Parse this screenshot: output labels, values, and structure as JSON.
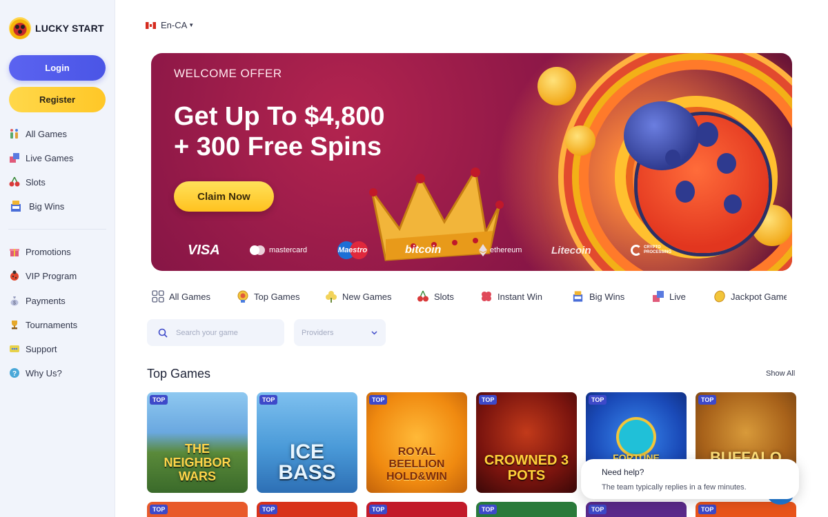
{
  "brand": {
    "name": "LUCKY START"
  },
  "auth": {
    "login_label": "Login",
    "register_label": "Register"
  },
  "sidebar": {
    "items": [
      {
        "label": "All Games",
        "icon": "all-games-icon"
      },
      {
        "label": "Live Games",
        "icon": "live-games-icon"
      },
      {
        "label": "Slots",
        "icon": "cherries-icon"
      },
      {
        "label": "Big Wins",
        "icon": "big-wins-icon"
      },
      {
        "label": "Promotions",
        "icon": "gift-icon"
      },
      {
        "label": "VIP Program",
        "icon": "ladybug-icon"
      },
      {
        "label": "Payments",
        "icon": "money-bag-icon"
      },
      {
        "label": "Tournaments",
        "icon": "trophy-icon"
      },
      {
        "label": "Support",
        "icon": "support-icon"
      },
      {
        "label": "Why Us?",
        "icon": "question-icon"
      }
    ]
  },
  "language": {
    "label": "En-CA"
  },
  "hero": {
    "kicker": "WELCOME OFFER",
    "title_line1": "Get Up To $4,800",
    "title_line2": "+ 300 Free Spins",
    "cta": "Claim Now",
    "payments": [
      "VISA",
      "mastercard",
      "Maestro",
      "bitcoin",
      "ethereum",
      "Litecoin",
      "CRYPTO PROCESSING"
    ]
  },
  "categories": [
    {
      "label": "All Games",
      "icon": "grid-icon"
    },
    {
      "label": "Top Games",
      "icon": "medal-icon"
    },
    {
      "label": "New Games",
      "icon": "clover-icon"
    },
    {
      "label": "Slots",
      "icon": "cherries-icon"
    },
    {
      "label": "Instant Win",
      "icon": "clover-red-icon"
    },
    {
      "label": "Big Wins",
      "icon": "big-wins-icon"
    },
    {
      "label": "Live",
      "icon": "live-icon"
    },
    {
      "label": "Jackpot Games",
      "icon": "coin-icon"
    }
  ],
  "search": {
    "placeholder": "Search your game"
  },
  "providers": {
    "placeholder": "Providers"
  },
  "top_games": {
    "title": "Top Games",
    "show_all": "Show All",
    "tag": "TOP",
    "cards": [
      {
        "name": "THE NEIGHBOR WARS"
      },
      {
        "name": "ICE BASS"
      },
      {
        "name": "ROYAL BEELLION HOLD&WIN"
      },
      {
        "name": "CROWNED 3 POTS"
      },
      {
        "name": "FORTUNE"
      },
      {
        "name": "BUFFALO"
      }
    ]
  },
  "chat": {
    "title": "Need help?",
    "subtitle": "The team typically replies in a few minutes."
  },
  "colors": {
    "accent": "#4a55e6",
    "register": "#ffc727",
    "hero_bg": "#8c1747",
    "tag_bg": "#3d49c9"
  }
}
